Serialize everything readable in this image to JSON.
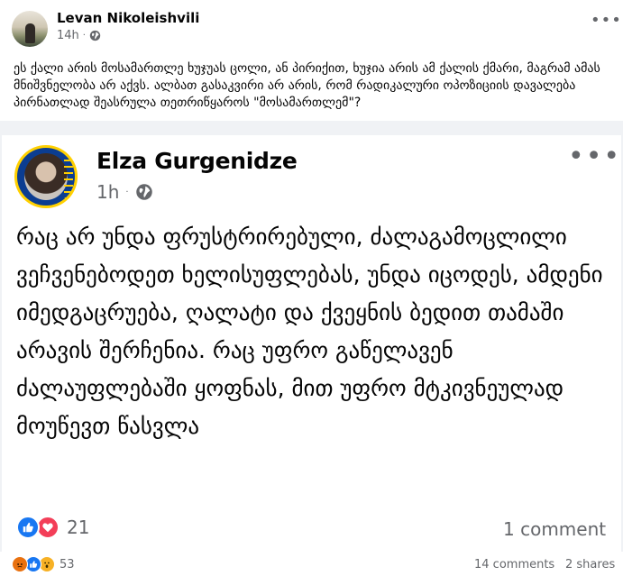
{
  "outer_post": {
    "author": "Levan Nikoleishvili",
    "time": "14h",
    "text": "ეს ქალი არის მოსამართლე ხუჯუას ცოლი, ან პირიქით, ხუჯია არის ამ ქალის ქმარი, მაგრამ ამას მნიშვნელობა არ აქვს. ალბათ გასაკვირი არ არის, რომ რადიკალური ოპოზიციის დავალება პირნათლად შეასრულა თეთრიწყაროს \"მოსამართლემ\"?",
    "reaction_count": "53",
    "comments": "14 comments",
    "shares": "2 shares",
    "reaction_icons": [
      "angry-icon",
      "like-icon",
      "wow-icon"
    ]
  },
  "shared_post": {
    "author": "Elza Gurgenidze",
    "time": "1h",
    "text": "რაც არ უნდა ფრუსტრირებული, ძალაგამოცლილი ვეჩვენებოდეთ ხელისუფლებას, უნდა იცოდეს, ამდენი იმედგაცრუება, ღალატი და ქვეყნის ბედით თამაში არავის შერჩენია. რაც უფრო გაწელავენ ძალაუფლებაში ყოფნას, მით უფრო მტკივნეულად მოუწევთ წასვლა",
    "reaction_count": "21",
    "comments": "1 comment",
    "reaction_icons": [
      "like-icon",
      "love-icon"
    ]
  },
  "icons": {
    "more": "more-options-icon",
    "privacy": "globe-icon"
  },
  "colors": {
    "like": "#1877f2",
    "love": "#f33e58",
    "angry": "#e9710f",
    "wow": "#f7b125",
    "secondary_text": "#65676b",
    "card_background": "#f0f2f5"
  }
}
